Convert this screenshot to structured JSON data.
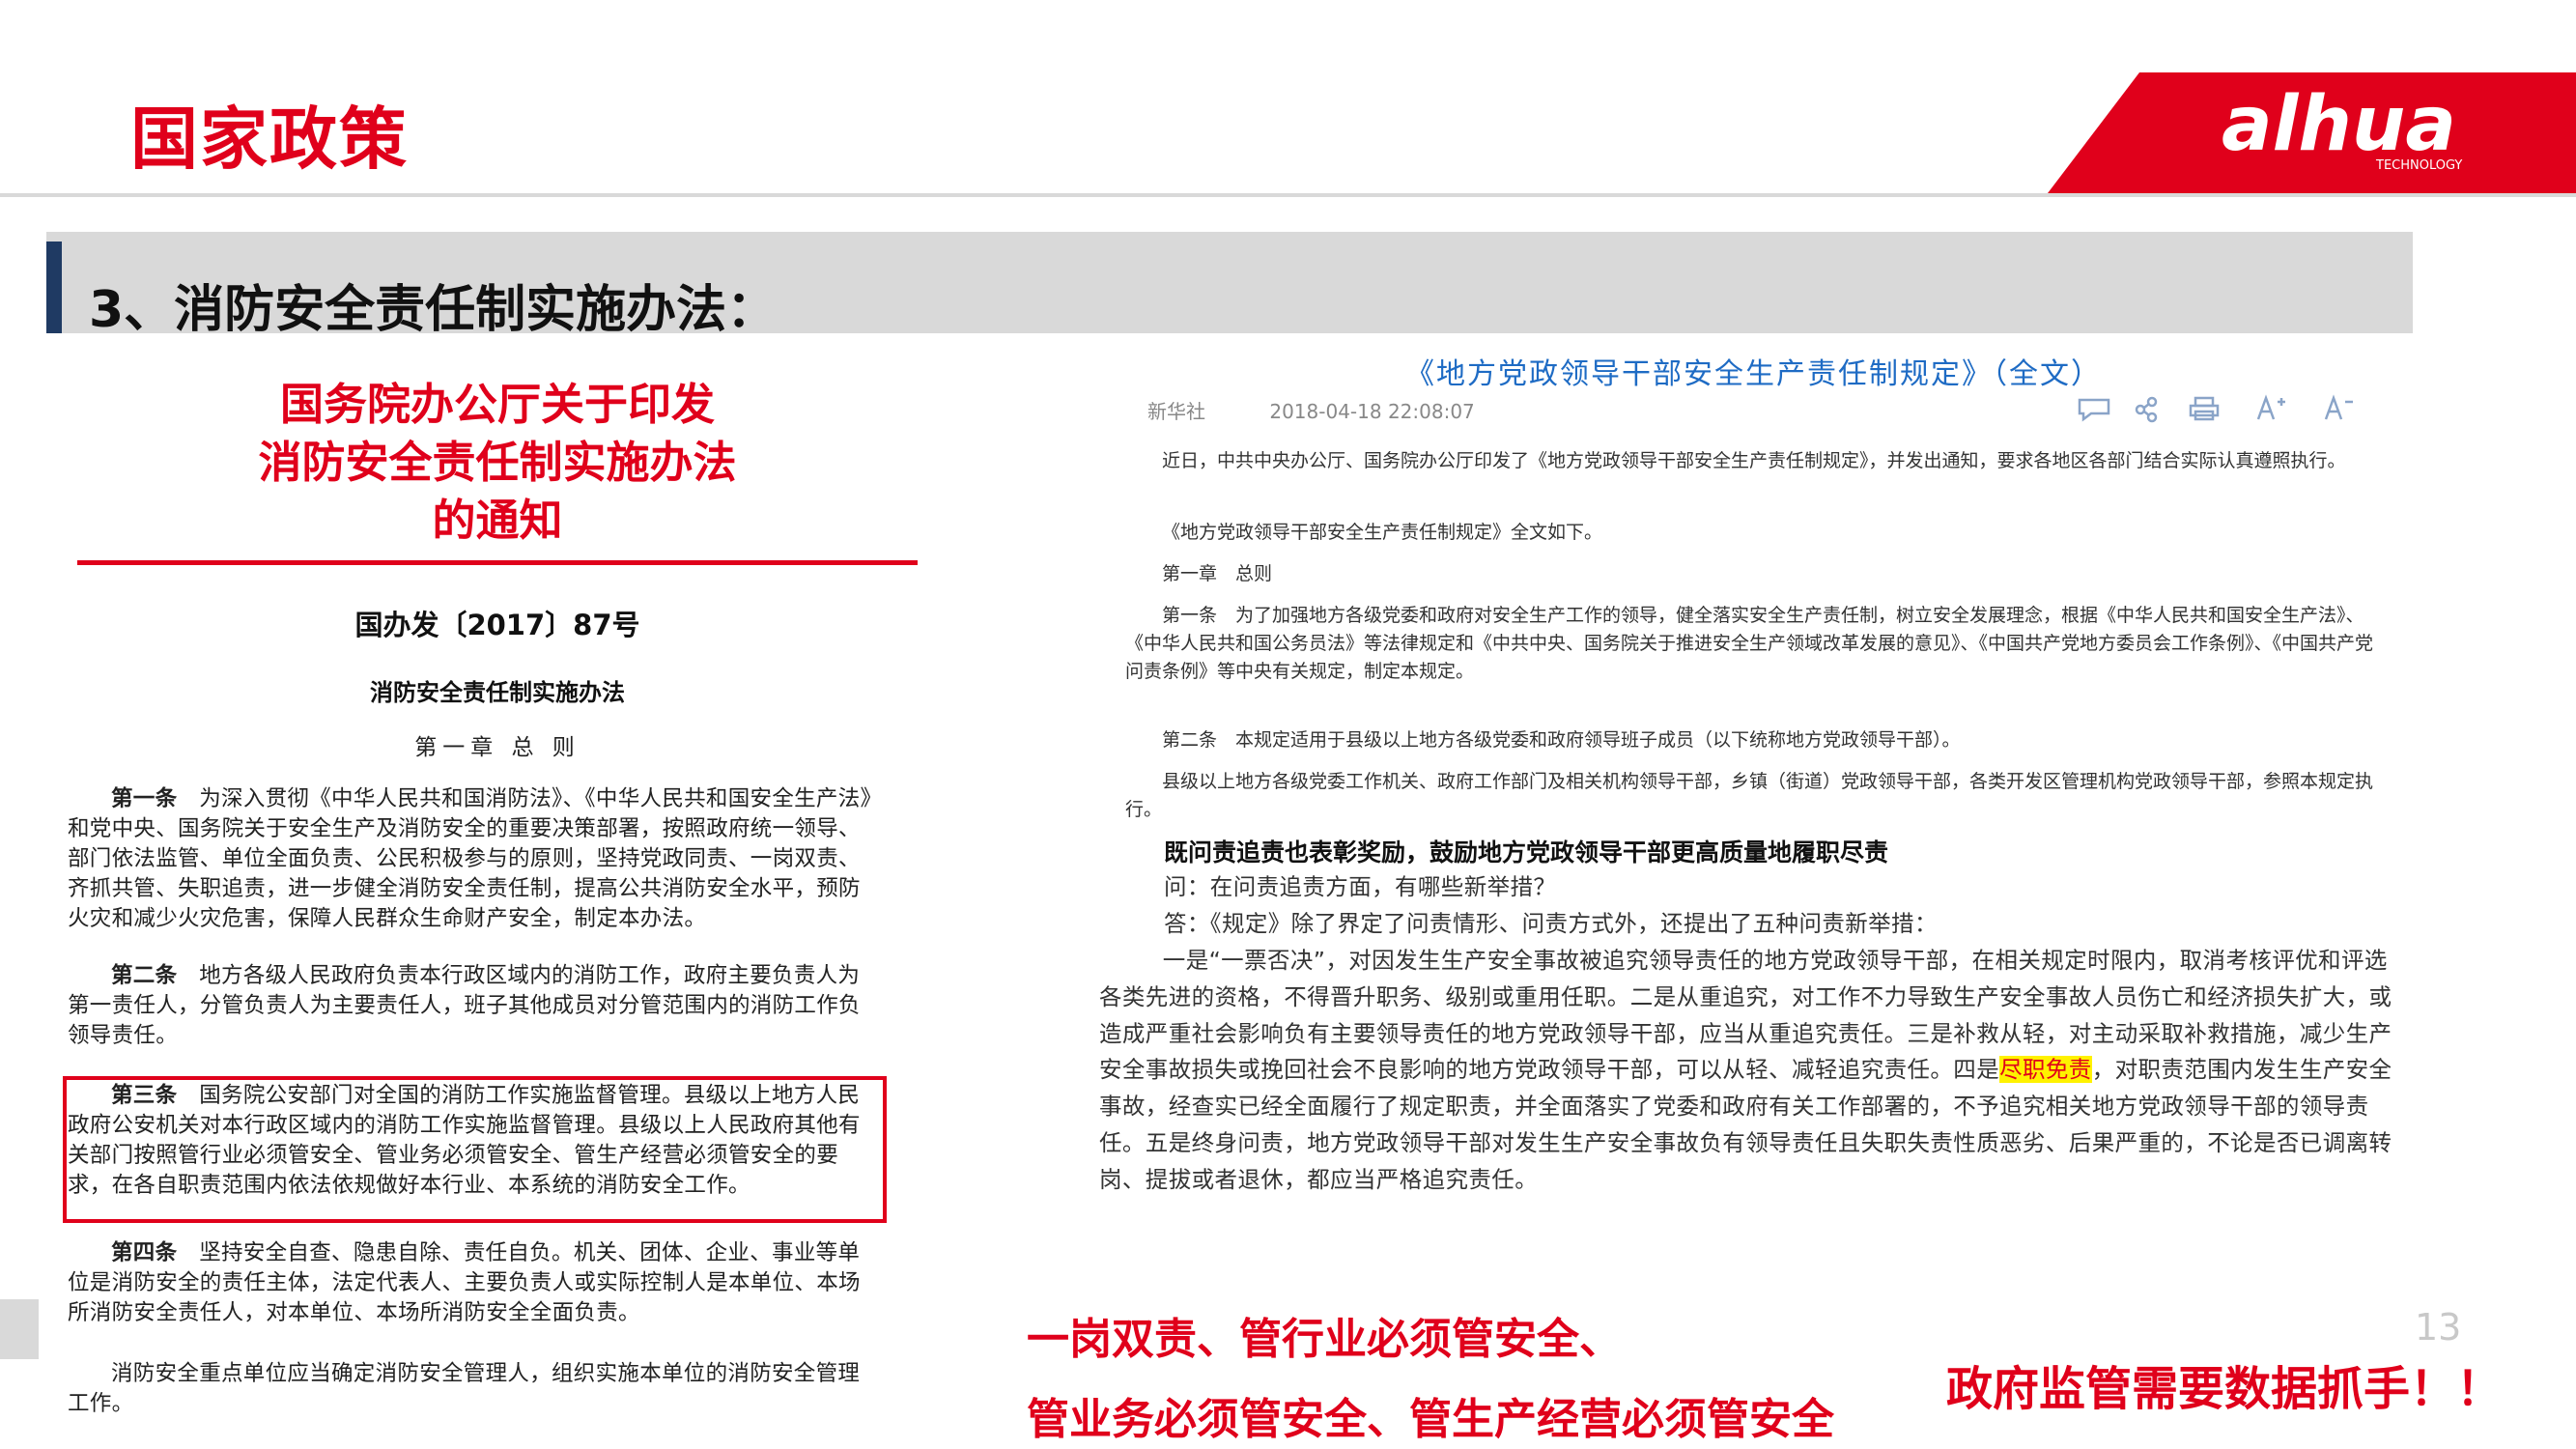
{
  "header": {
    "title": "国家政策",
    "logo_text": "alhua",
    "logo_subtext": "TECHNOLOGY",
    "brand_color": "#e0001b"
  },
  "section": {
    "title": "3、消防安全责任制实施办法："
  },
  "left_doc": {
    "headline_lines": [
      "国务院办公厅关于印发",
      "消防安全责任制实施办法",
      "的通知"
    ],
    "doc_number": "国办发〔2017〕87号",
    "subtitle": "消防安全责任制实施办法",
    "chapter": "第一章  总  则",
    "articles": [
      {
        "label": "第一条",
        "text": "为深入贯彻《中华人民共和国消防法》、《中华人民共和国安全生产法》和党中央、国务院关于安全生产及消防安全的重要决策部署，按照政府统一领导、部门依法监管、单位全面负责、公民积极参与的原则，坚持党政同责、一岗双责、齐抓共管、失职追责，进一步健全消防安全责任制，提高公共消防安全水平，预防火灾和减少火灾危害，保障人民群众生命财产安全，制定本办法。"
      },
      {
        "label": "第二条",
        "text": "地方各级人民政府负责本行政区域内的消防工作，政府主要负责人为第一责任人，分管负责人为主要责任人，班子其他成员对分管范围内的消防工作负领导责任。"
      },
      {
        "label": "第三条",
        "text": "国务院公安部门对全国的消防工作实施监督管理。县级以上地方人民政府公安机关对本行政区域内的消防工作实施监督管理。县级以上人民政府其他有关部门按照管行业必须管安全、管业务必须管安全、管生产经营必须管安全的要求，在各自职责范围内依法依规做好本行业、本系统的消防安全工作。"
      },
      {
        "label": "第四条",
        "text": "坚持安全自查、隐患自除、责任自负。机关、团体、企业、事业等单位是消防安全的责任主体，法定代表人、主要负责人或实际控制人是本单位、本场所消防安全责任人，对本单位、本场所消防安全全面负责。"
      },
      {
        "label": "",
        "text": "消防安全重点单位应当确定消防安全管理人，组织实施本单位的消防安全管理工作。"
      }
    ]
  },
  "right_doc": {
    "title": "《地方党政领导干部安全生产责任制规定》（全文）",
    "source": "新华社",
    "datetime": "2018-04-18 22:08:07",
    "intro_1": "近日，中共中央办公厅、国务院办公厅印发了《地方党政领导干部安全生产责任制规定》，并发出通知，要求各地区各部门结合实际认真遵照执行。",
    "intro_2": "《地方党政领导干部安全生产责任制规定》全文如下。",
    "chapter": "第一章　总则",
    "art1": "第一条　为了加强地方各级党委和政府对安全生产工作的领导，健全落实安全生产责任制，树立安全发展理念，根据《中华人民共和国安全生产法》、《中华人民共和国公务员法》等法律规定和《中共中央、国务院关于推进安全生产领域改革发展的意见》、《中国共产党地方委员会工作条例》、《中国共产党问责条例》等中央有关规定，制定本规定。",
    "art2": "第二条　本规定适用于县级以上地方各级党委和政府领导班子成员（以下统称地方党政领导干部）。",
    "art2b": "县级以上地方各级党委工作机关、政府工作部门及相关机构领导干部，乡镇（街道）党政领导干部，各类开发区管理机构党政领导干部，参照本规定执行。",
    "heading": "既问责追责也表彰奖励，鼓励地方党政领导干部更高质量地履职尽责",
    "question": "问：在问责追责方面，有哪些新举措？",
    "answer_lead": "答：《规定》除了界定了问责情形、问责方式外，还提出了五种问责新举措：",
    "answer_part1": "一是“一票否决”，对因发生生产安全事故被追究领导责任的地方党政领导干部，在相关规定时限内，取消考核评优和评选各类先进的资格，不得晋升职务、级别或重用任职。二是从重追究，对工作不力导致生产安全事故人员伤亡和经济损失扩大，或造成严重社会影响负有主要领导责任的地方党政领导干部，应当从重追究责任。三是补救从轻，对主动采取补救措施，减少生产安全事故损失或挽回社会不良影响的地方党政领导干部，可以从轻、减轻追究责任。四是",
    "answer_highlight": "尽职免责",
    "answer_part2": "，对职责范围内发生生产安全事故，经查实已经全面履行了规定职责，并全面落实了党委和政府有关工作部署的，不予追究相关地方党政领导干部的领导责任。五是终身问责，地方党政领导干部对发生生产安全事故负有领导责任且失职失责性质恶劣、后果严重的，不论是否已调离转岗、提拔或者退休，都应当严格追究责任。"
  },
  "captions": {
    "line1": "一岗双责、管行业必须管安全、",
    "line2": "管业务必须管安全、管生产经营必须管安全",
    "right": "政府监管需要数据抓手！！"
  },
  "page_number": "13"
}
